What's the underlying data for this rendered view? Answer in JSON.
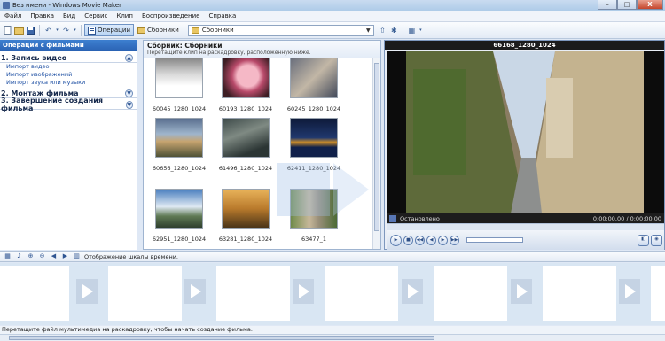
{
  "window": {
    "title": "Без имени - Windows Movie Maker",
    "minimize": "–",
    "maximize": "□",
    "close": "X"
  },
  "menu": [
    "Файл",
    "Правка",
    "Вид",
    "Сервис",
    "Клип",
    "Воспроизведение",
    "Справка"
  ],
  "toolbar": {
    "operations_label": "Операции",
    "collections_label": "Сборники",
    "collection_select_value": "Сборники"
  },
  "taskpane": {
    "header": "Операции с фильмами",
    "sections": [
      {
        "title": "1. Запись видео",
        "links": [
          "Импорт видео",
          "Импорт изображений",
          "Импорт звука или музыки"
        ]
      },
      {
        "title": "2. Монтаж фильма",
        "links": []
      },
      {
        "title": "3. Завершение создания фильма",
        "links": []
      }
    ]
  },
  "collection": {
    "title": "Сборник: Сборники",
    "subtitle": "Перетащите клип на раскадровку, расположенную ниже.",
    "clips": [
      {
        "label": "60045_1280_1024"
      },
      {
        "label": "60193_1280_1024"
      },
      {
        "label": "60245_1280_1024"
      },
      {
        "label": "60656_1280_1024"
      },
      {
        "label": "61496_1280_1024"
      },
      {
        "label": "62411_1280_1024"
      },
      {
        "label": "62951_1280_1024"
      },
      {
        "label": "63281_1280_1024"
      },
      {
        "label": "63477_1"
      }
    ]
  },
  "preview": {
    "title": "66168_1280_1024",
    "status": "Остановлено",
    "time": "0:00:00,00 / 0:00:00,00"
  },
  "timeline": {
    "toggle_label": "Отображение шкалы времени."
  },
  "storyboard": {
    "status": "Перетащите файл мультимедиа на раскадровку, чтобы начать создание фильма."
  },
  "colors": {
    "accent": "#2a62b3",
    "storyboard": "#d9e6f3"
  }
}
